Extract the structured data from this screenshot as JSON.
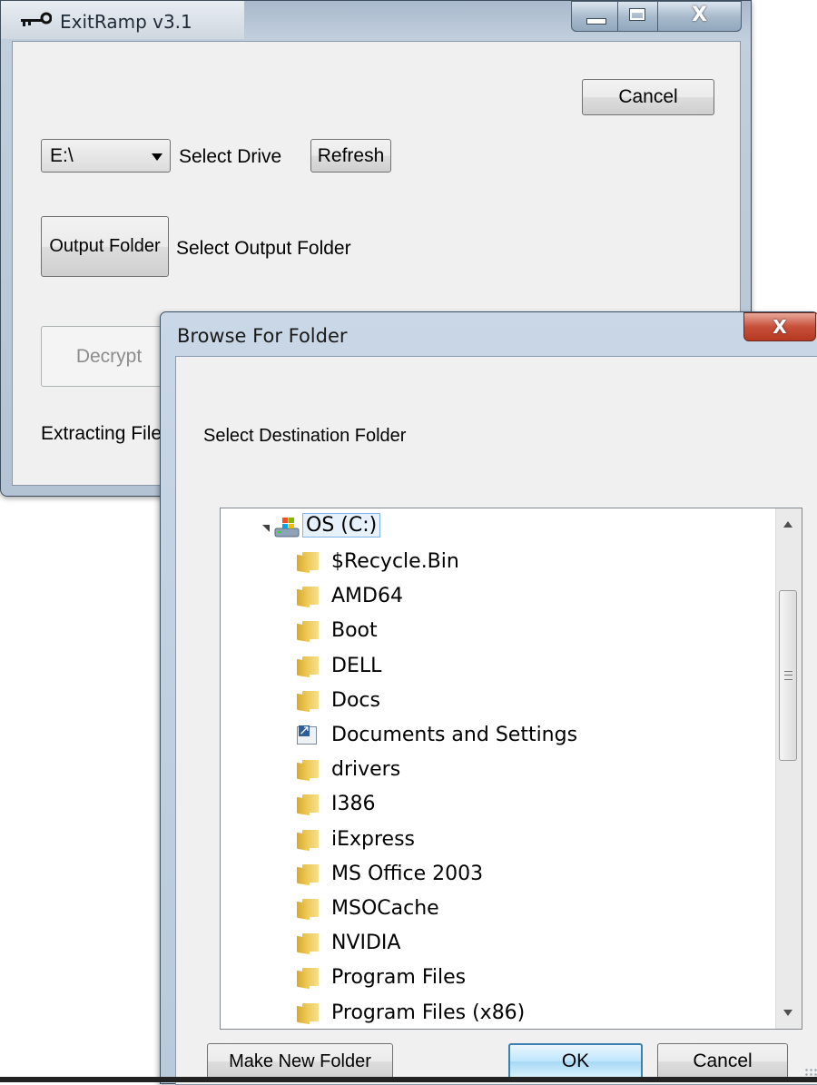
{
  "main_window": {
    "title": "ExitRamp v3.1",
    "cancel_label": "Cancel",
    "drive_value": "E:\\",
    "select_drive_label": "Select Drive",
    "refresh_label": "Refresh",
    "output_folder_label": "Output Folder",
    "select_output_label": "Select Output Folder",
    "decrypt_label": "Decrypt",
    "status_text": "Extracting File"
  },
  "dialog": {
    "title": "Browse For Folder",
    "close_glyph": "X",
    "prompt": "Select Destination Folder",
    "tree": {
      "root": "OS (C:)",
      "items": [
        {
          "label": "$Recycle.Bin",
          "expandable": true,
          "icon": "folder-icon"
        },
        {
          "label": "AMD64",
          "expandable": true,
          "icon": "folder-icon"
        },
        {
          "label": "Boot",
          "expandable": true,
          "icon": "folder-icon"
        },
        {
          "label": "DELL",
          "expandable": false,
          "icon": "folder-icon"
        },
        {
          "label": "Docs",
          "expandable": true,
          "icon": "folder-icon"
        },
        {
          "label": "Documents and Settings",
          "expandable": true,
          "icon": "shortcut-folder-icon"
        },
        {
          "label": "drivers",
          "expandable": true,
          "icon": "folder-icon"
        },
        {
          "label": "I386",
          "expandable": true,
          "icon": "folder-icon"
        },
        {
          "label": "iExpress",
          "expandable": false,
          "icon": "folder-icon"
        },
        {
          "label": "MS Office 2003",
          "expandable": true,
          "icon": "folder-icon"
        },
        {
          "label": "MSOCache",
          "expandable": true,
          "icon": "folder-icon"
        },
        {
          "label": "NVIDIA",
          "expandable": true,
          "icon": "folder-icon"
        },
        {
          "label": "Program Files",
          "expandable": true,
          "icon": "folder-icon"
        },
        {
          "label": "Program Files (x86)",
          "expandable": true,
          "icon": "folder-icon"
        }
      ]
    },
    "make_new_folder_label": "Make New Folder",
    "ok_label": "OK",
    "cancel_label": "Cancel"
  },
  "colors": {
    "accent_blue": "#3c7fb1",
    "close_red": "#c7503a"
  }
}
